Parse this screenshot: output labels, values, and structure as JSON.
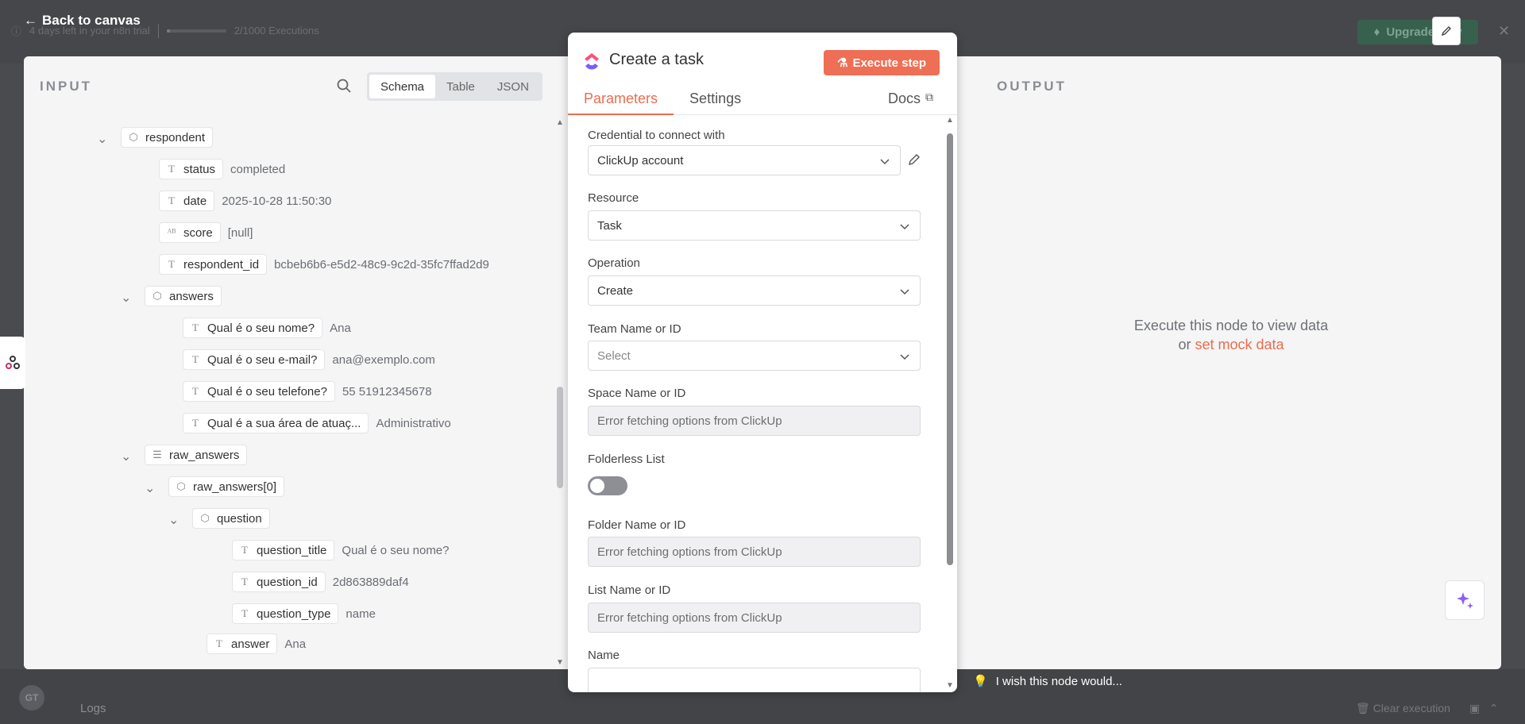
{
  "topbar": {
    "trial_text": "4 days left in your n8n trial",
    "executions_text": "2/1000 Executions",
    "executions_progress": 0.002,
    "upgrade_label": "Upgrade now",
    "back_label": "Back to canvas"
  },
  "bottombar": {
    "avatar_initials": "GT",
    "logs_label": "Logs",
    "clear_label": "Clear execution",
    "wish_label": "I wish this node would..."
  },
  "input": {
    "title": "INPUT",
    "modes": [
      "Schema",
      "Table",
      "JSON"
    ],
    "active_mode": "Schema",
    "tree": [
      {
        "type": "object",
        "name": "respondent",
        "value": ""
      },
      {
        "type": "string",
        "name": "status",
        "value": "completed"
      },
      {
        "type": "string",
        "name": "date",
        "value": "2025-10-28 11:50:30"
      },
      {
        "type": "mixed",
        "name": "score",
        "value": "[null]"
      },
      {
        "type": "string",
        "name": "respondent_id",
        "value": "bcbeb6b6-e5d2-48c9-9c2d-35fc7ffad2d9"
      },
      {
        "type": "object",
        "name": "answers",
        "value": ""
      },
      {
        "type": "string",
        "name": "Qual é o seu nome?",
        "value": "Ana"
      },
      {
        "type": "string",
        "name": "Qual é o seu e-mail?",
        "value": "ana@exemplo.com"
      },
      {
        "type": "string",
        "name": "Qual é o seu telefone?",
        "value": "55 51912345678"
      },
      {
        "type": "string",
        "name": "Qual é a sua área de atuaç...",
        "value": "Administrativo"
      },
      {
        "type": "array",
        "name": "raw_answers",
        "value": ""
      },
      {
        "type": "object",
        "name": "raw_answers[0]",
        "value": ""
      },
      {
        "type": "object",
        "name": "question",
        "value": ""
      },
      {
        "type": "string",
        "name": "question_title",
        "value": "Qual é o seu nome?"
      },
      {
        "type": "string",
        "name": "question_id",
        "value": "2d863889daf4"
      },
      {
        "type": "string",
        "name": "question_type",
        "value": "name"
      },
      {
        "type": "string",
        "name": "answer",
        "value": "Ana"
      }
    ]
  },
  "output": {
    "title": "OUTPUT",
    "message_line1": "Execute this node to view data",
    "message_or": "or",
    "mock_link": "set mock data"
  },
  "node": {
    "title": "Create a task",
    "execute_label": "Execute step",
    "tabs": [
      "Parameters",
      "Settings"
    ],
    "active_tab": "Parameters",
    "docs_label": "Docs",
    "fields": {
      "credential_label": "Credential to connect with",
      "credential_value": "ClickUp account",
      "resource_label": "Resource",
      "resource_value": "Task",
      "operation_label": "Operation",
      "operation_value": "Create",
      "team_label": "Team Name or ID",
      "team_placeholder": "Select",
      "space_label": "Space Name or ID",
      "space_value": "Error fetching options from ClickUp",
      "folderless_label": "Folderless List",
      "folderless_on": false,
      "folder_label": "Folder Name or ID",
      "folder_value": "Error fetching options from ClickUp",
      "list_label": "List Name or ID",
      "list_value": "Error fetching options from ClickUp",
      "name_label": "Name",
      "name_value": ""
    }
  },
  "colors": {
    "accent": "#ea6d4e",
    "execute_bg": "#ee6f55",
    "upgrade_bg": "#38604e"
  }
}
